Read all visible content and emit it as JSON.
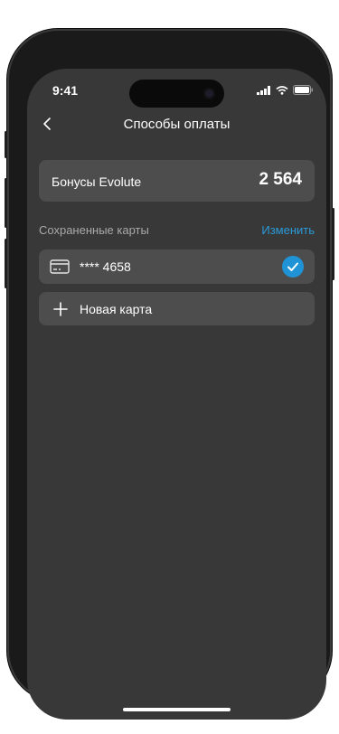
{
  "status": {
    "time": "9:41"
  },
  "nav": {
    "title": "Способы оплаты"
  },
  "bonus": {
    "label": "Бонусы Evolute",
    "value": "2 564"
  },
  "saved_cards": {
    "label": "Сохраненные карты",
    "edit_label": "Изменить",
    "cards": [
      {
        "number": "**** 4658",
        "selected": true
      }
    ]
  },
  "new_card": {
    "label": "Новая карта"
  },
  "colors": {
    "background": "#383838",
    "card": "#4d4d4d",
    "accent": "#2a9ad9"
  },
  "icons": [
    "back-chevron-icon",
    "signal-icon",
    "wifi-icon",
    "battery-icon",
    "credit-card-icon",
    "checkmark-icon",
    "plus-icon"
  ]
}
